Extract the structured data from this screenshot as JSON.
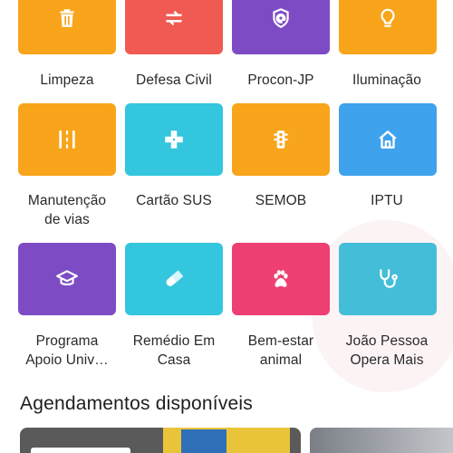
{
  "services": [
    {
      "label": "Limpeza",
      "icon": "trash-icon",
      "color": "#F8A51B"
    },
    {
      "label": "Defesa Civil",
      "icon": "swap-icon",
      "color": "#F05A53"
    },
    {
      "label": "Procon-JP",
      "icon": "shield-at-icon",
      "color": "#7D4CC4"
    },
    {
      "label": "Iluminação",
      "icon": "lightbulb-icon",
      "color": "#F8A51B"
    },
    {
      "label": "Manutenção\nde vias",
      "icon": "road-icon",
      "color": "#F8A51B"
    },
    {
      "label": "Cartão SUS",
      "icon": "health-cross-icon",
      "color": "#33C6DE"
    },
    {
      "label": "SEMOB",
      "icon": "traffic-light-icon",
      "color": "#F8A51B"
    },
    {
      "label": "IPTU",
      "icon": "house-icon",
      "color": "#3FA2EC"
    },
    {
      "label": "Programa\nApoio Univ…",
      "icon": "graduation-cap-icon",
      "color": "#7D4CC4"
    },
    {
      "label": "Remédio Em\nCasa",
      "icon": "pill-icon",
      "color": "#33C6DE"
    },
    {
      "label": "Bem-estar\nanimal",
      "icon": "paw-icon",
      "color": "#EE3F72"
    },
    {
      "label": "João Pessoa\nOpera Mais",
      "icon": "stethoscope-icon",
      "color": "#44BDD8"
    }
  ],
  "section": {
    "title": "Agendamentos disponíveis"
  }
}
